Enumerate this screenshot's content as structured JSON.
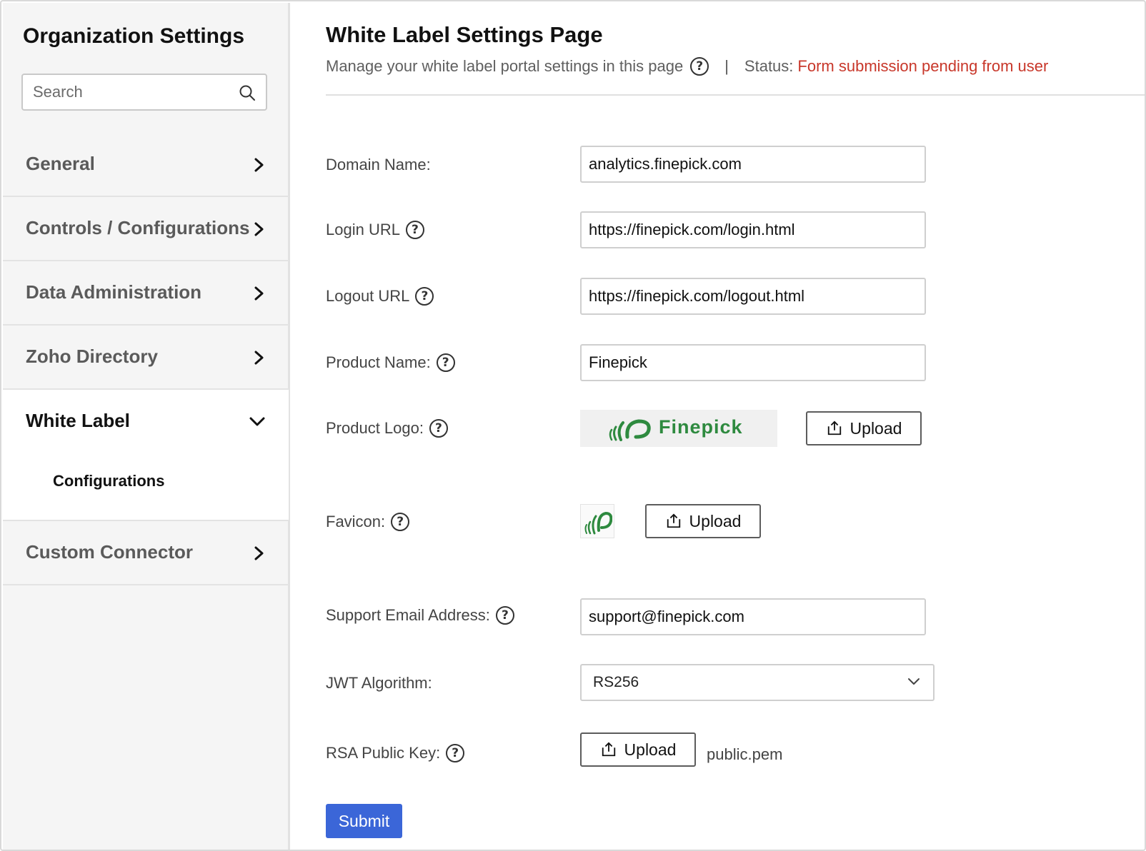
{
  "sidebar": {
    "title": "Organization Settings",
    "search_placeholder": "Search",
    "items": [
      {
        "label": "General"
      },
      {
        "label": "Controls / Configurations"
      },
      {
        "label": "Data Administration"
      },
      {
        "label": "Zoho Directory"
      },
      {
        "label": "White Label",
        "expanded": true,
        "sub_items": [
          {
            "label": "Configurations"
          }
        ]
      },
      {
        "label": "Custom Connector"
      }
    ]
  },
  "header": {
    "title": "White Label Settings Page",
    "subtitle": "Manage your white label portal settings in this page",
    "separator": "|",
    "status_label": "Status:",
    "status_value": "Form submission pending from user"
  },
  "form": {
    "domain_label": "Domain Name:",
    "domain_value": "analytics.finepick.com",
    "login_label": "Login URL",
    "login_value": "https://finepick.com/login.html",
    "logout_label": "Logout URL",
    "logout_value": "https://finepick.com/logout.html",
    "product_name_label": "Product Name:",
    "product_name_value": "Finepick",
    "product_logo_label": "Product Logo:",
    "product_logo_text": "Finepick",
    "favicon_label": "Favicon:",
    "upload_label": "Upload",
    "support_email_label": "Support Email Address:",
    "support_email_value": "support@finepick.com",
    "jwt_label": "JWT Algorithm:",
    "jwt_value": "RS256",
    "rsa_label": "RSA Public Key:",
    "rsa_file": "public.pem",
    "submit_label": "Submit",
    "help_glyph": "?"
  },
  "colors": {
    "accent": "#3b66d8",
    "status": "#c8372a",
    "logo_green": "#2e8a3f",
    "sidebar_bg": "#f5f5f5"
  },
  "icons": [
    "search-icon",
    "chevron-right-icon",
    "chevron-down-icon",
    "help-icon",
    "upload-icon",
    "finepick-logo-icon"
  ]
}
